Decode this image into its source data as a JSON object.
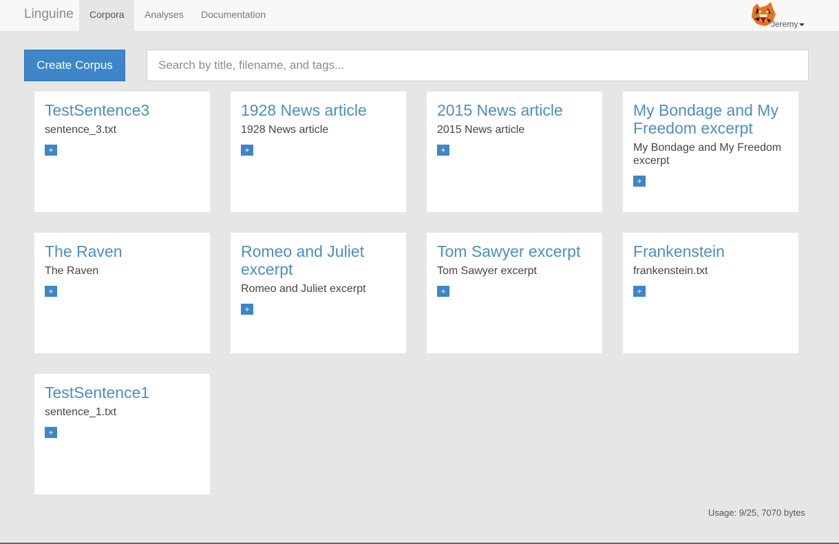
{
  "nav": {
    "brand": "Linguine",
    "tabs": [
      {
        "label": "Corpora",
        "active": true
      },
      {
        "label": "Analyses",
        "active": false
      },
      {
        "label": "Documentation",
        "active": false
      }
    ],
    "user": "Jeremy",
    "avatar_icon": "tiger-mascot-icon"
  },
  "toolbar": {
    "create_label": "Create Corpus",
    "search_placeholder": "Search by title, filename, and tags..."
  },
  "corpora": [
    {
      "title": "TestSentence3",
      "file": "sentence_3.txt"
    },
    {
      "title": "1928 News article",
      "file": "1928 News article"
    },
    {
      "title": "2015 News article",
      "file": "2015 News article"
    },
    {
      "title": "My Bondage and My Freedom excerpt",
      "file": "My Bondage and My Freedom excerpt"
    },
    {
      "title": "The Raven",
      "file": "The Raven"
    },
    {
      "title": "Romeo and Juliet excerpt",
      "file": "Romeo and Juliet excerpt"
    },
    {
      "title": "Tom Sawyer excerpt",
      "file": "Tom Sawyer excerpt"
    },
    {
      "title": "Frankenstein",
      "file": "frankenstein.txt"
    },
    {
      "title": "TestSentence1",
      "file": "sentence_1.txt"
    }
  ],
  "add_tag_label": "+",
  "usage": "Usage: 9/25, 7070 bytes",
  "colors": {
    "accent": "#3c86c9",
    "title": "#4a8ec8",
    "background": "#e6e6e6"
  }
}
